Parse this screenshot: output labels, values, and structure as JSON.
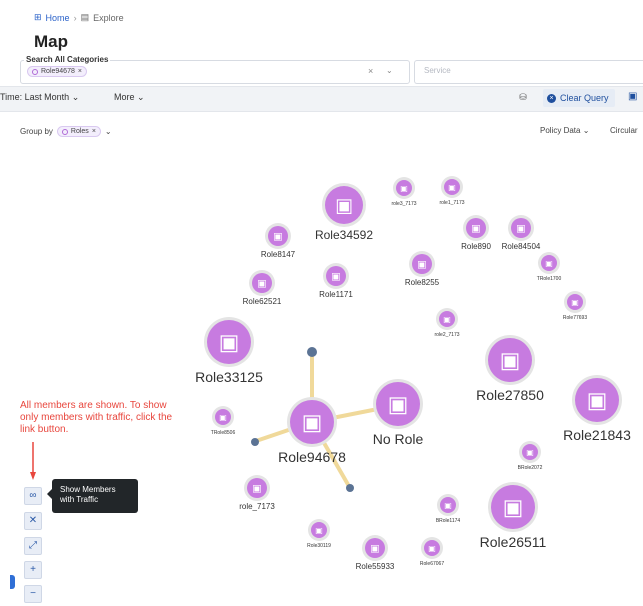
{
  "breadcrumb": {
    "home": "Home",
    "explore": "Explore"
  },
  "page_title": "Map",
  "search": {
    "label": "Search All Categories",
    "chip": "Role94678",
    "service_placeholder": "Service"
  },
  "toolbar": {
    "time": "Time: Last Month",
    "more": "More",
    "clear_query": "Clear Query"
  },
  "groupby": {
    "label": "Group by",
    "chip": "Roles",
    "policy": "Policy Data",
    "layout": "Circular"
  },
  "annotation": "All members are shown. To show only members with traffic, click the link button.",
  "tooltip": "Show Members with Traffic",
  "nodes": [
    {
      "label": "Role34592",
      "size": "large"
    },
    {
      "label": "role3_7173",
      "size": "tiny"
    },
    {
      "label": "role1_7173",
      "size": "tiny"
    },
    {
      "label": "Role890",
      "size": "small"
    },
    {
      "label": "Role84504",
      "size": "small"
    },
    {
      "label": "Role8147",
      "size": "small"
    },
    {
      "label": "Role1171",
      "size": "small"
    },
    {
      "label": "Role8255",
      "size": "small"
    },
    {
      "label": "TRole1700",
      "size": "tiny"
    },
    {
      "label": "Role62521",
      "size": "small"
    },
    {
      "label": "Role77693",
      "size": "tiny"
    },
    {
      "label": "role2_7173",
      "size": "tiny"
    },
    {
      "label": "Role33125",
      "size": "xl"
    },
    {
      "label": "Role27850",
      "size": "xl"
    },
    {
      "label": "Role21843",
      "size": "xl"
    },
    {
      "label": "No Role",
      "size": "xl"
    },
    {
      "label": "Role94678",
      "size": "xl"
    },
    {
      "label": "TRole8506",
      "size": "tiny"
    },
    {
      "label": "BRole2072",
      "size": "tiny"
    },
    {
      "label": "role_7173",
      "size": "small"
    },
    {
      "label": "BRole1174",
      "size": "tiny"
    },
    {
      "label": "Role26511",
      "size": "xl"
    },
    {
      "label": "Role30119",
      "size": "tiny"
    },
    {
      "label": "Role55933",
      "size": "small"
    },
    {
      "label": "Role67067",
      "size": "tiny"
    }
  ],
  "colors": {
    "accent": "#2b62c9",
    "node": "#c77be0",
    "edge": "#f0d99a",
    "annotation": "#e8463d"
  }
}
